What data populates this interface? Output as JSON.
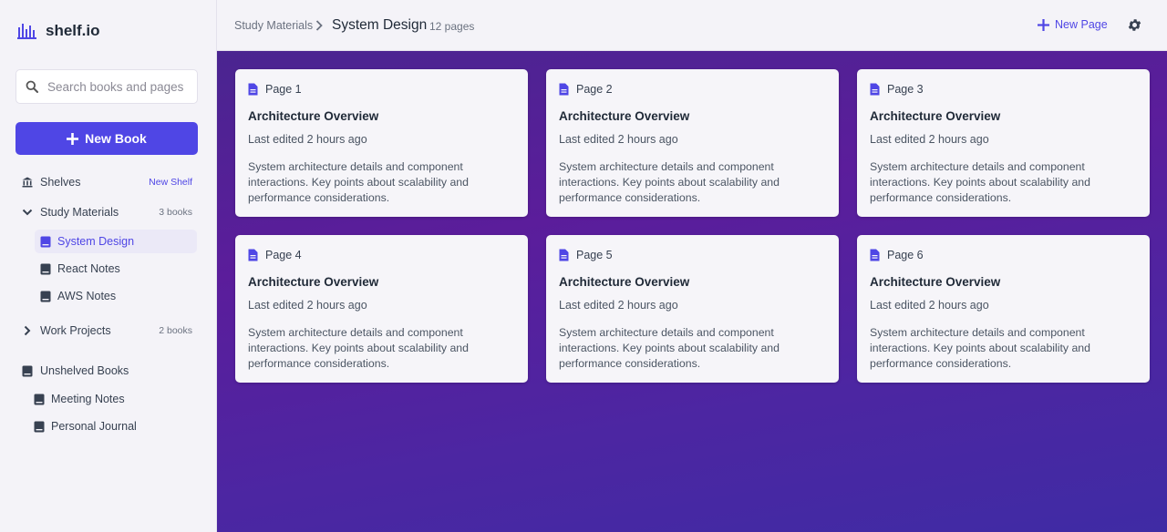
{
  "app": {
    "name": "shelf.io"
  },
  "sidebar": {
    "search_placeholder": "Search books and pages...",
    "new_book_label": "New Book",
    "shelves_label": "Shelves",
    "new_shelf_label": "New Shelf",
    "shelves": [
      {
        "label": "Study Materials",
        "count": "3 books",
        "expanded": true,
        "books": [
          {
            "label": "System Design",
            "active": true
          },
          {
            "label": "React Notes",
            "active": false
          },
          {
            "label": "AWS Notes",
            "active": false
          }
        ]
      },
      {
        "label": "Work Projects",
        "count": "2 books",
        "expanded": false
      }
    ],
    "unshelved": {
      "label": "Unshelved Books",
      "books": [
        {
          "label": "Meeting Notes"
        },
        {
          "label": "Personal Journal"
        }
      ]
    }
  },
  "header": {
    "breadcrumb_parent": "Study Materials",
    "title": "System Design",
    "page_count": "12 pages",
    "new_page_label": "New Page"
  },
  "pages": [
    {
      "page": "Page 1",
      "title": "Architecture Overview",
      "edited": "Last edited 2 hours ago",
      "description": "System architecture details and component interactions. Key points about scalability and performance considerations."
    },
    {
      "page": "Page 2",
      "title": "Architecture Overview",
      "edited": "Last edited 2 hours ago",
      "description": "System architecture details and component interactions. Key points about scalability and performance considerations."
    },
    {
      "page": "Page 3",
      "title": "Architecture Overview",
      "edited": "Last edited 2 hours ago",
      "description": "System architecture details and component interactions. Key points about scalability and performance considerations."
    },
    {
      "page": "Page 4",
      "title": "Architecture Overview",
      "edited": "Last edited 2 hours ago",
      "description": "System architecture details and component interactions. Key points about scalability and performance considerations."
    },
    {
      "page": "Page 5",
      "title": "Architecture Overview",
      "edited": "Last edited 2 hours ago",
      "description": "System architecture details and component interactions. Key points about scalability and performance considerations."
    },
    {
      "page": "Page 6",
      "title": "Architecture Overview",
      "edited": "Last edited 2 hours ago",
      "description": "System architecture details and component interactions. Key points about scalability and performance considerations."
    }
  ],
  "colors": {
    "accent": "#4f46e5",
    "sidebar_bg": "#f4f3f8",
    "canvas_gradient_start": "#4a2590",
    "canvas_gradient_end": "#3f2ba4"
  },
  "icons": {
    "logo": "bar-chart-logo-icon",
    "search": "search-icon",
    "plus": "plus-icon",
    "shelves": "bank-icon",
    "chevron_down": "chevron-down-icon",
    "chevron_right": "chevron-right-icon",
    "book": "book-icon",
    "page": "document-icon",
    "settings": "gear-icon"
  }
}
